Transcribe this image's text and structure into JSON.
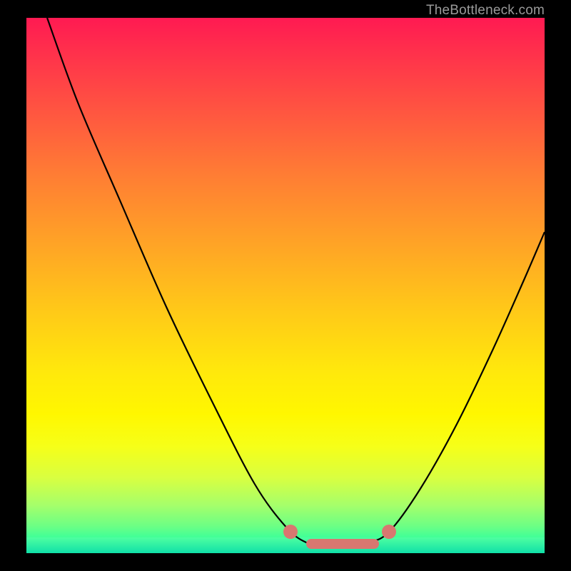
{
  "watermark": "TheBottleneck.com",
  "colors": {
    "frame": "#000000",
    "marker": "#d97770",
    "curve_stroke": "#000000"
  },
  "chart_data": {
    "type": "line",
    "title": "",
    "xlabel": "",
    "ylabel": "",
    "xlim": [
      0,
      100
    ],
    "ylim": [
      0,
      100
    ],
    "grid": false,
    "legend": false,
    "curve_points": [
      {
        "x": 4,
        "y": 100
      },
      {
        "x": 10,
        "y": 84
      },
      {
        "x": 18,
        "y": 66
      },
      {
        "x": 27,
        "y": 46
      },
      {
        "x": 36,
        "y": 28
      },
      {
        "x": 44,
        "y": 13
      },
      {
        "x": 50,
        "y": 5
      },
      {
        "x": 54,
        "y": 2
      },
      {
        "x": 58,
        "y": 1.5
      },
      {
        "x": 62,
        "y": 1.5
      },
      {
        "x": 66,
        "y": 2
      },
      {
        "x": 70,
        "y": 4
      },
      {
        "x": 76,
        "y": 12
      },
      {
        "x": 83,
        "y": 24
      },
      {
        "x": 90,
        "y": 38
      },
      {
        "x": 96,
        "y": 51
      },
      {
        "x": 100,
        "y": 60
      }
    ],
    "flat_zone_xrange": [
      54,
      68
    ],
    "markers": [
      {
        "x": 51,
        "y": 4
      },
      {
        "x": 70,
        "y": 4
      }
    ]
  }
}
